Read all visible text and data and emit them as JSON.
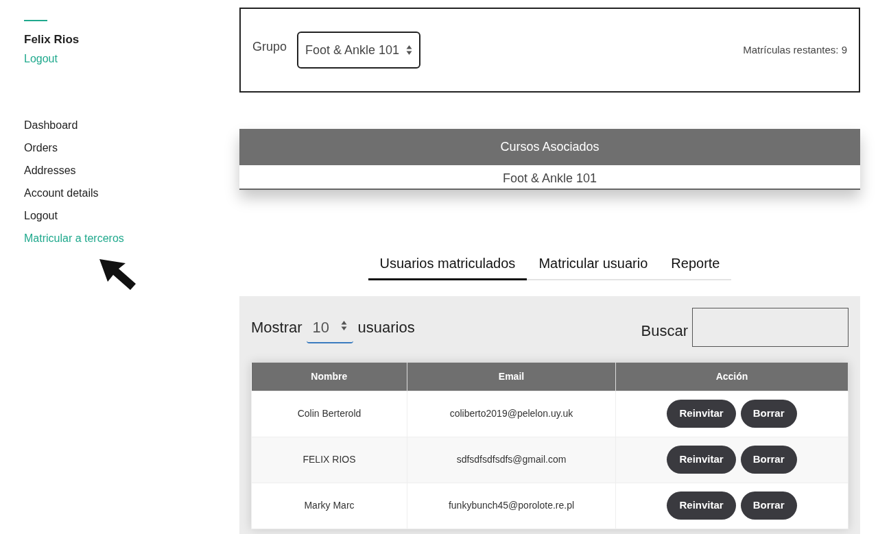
{
  "user": {
    "name": "Felix Rios",
    "logout": "Logout"
  },
  "sidebar": {
    "items": [
      {
        "label": "Dashboard",
        "selected": false
      },
      {
        "label": "Orders",
        "selected": false
      },
      {
        "label": "Addresses",
        "selected": false
      },
      {
        "label": "Account details",
        "selected": false
      },
      {
        "label": "Logout",
        "selected": false
      },
      {
        "label": "Matricular a terceros",
        "selected": true
      }
    ]
  },
  "group": {
    "label": "Grupo",
    "value": "Foot & Ankle 101",
    "remaining": "Matrículas restantes: 9"
  },
  "courses": {
    "title": "Cursos Asociados",
    "items": [
      "Foot & Ankle 101"
    ]
  },
  "tabs": [
    {
      "label": "Usuarios matriculados",
      "selected": true
    },
    {
      "label": "Matricular usuario",
      "selected": false
    },
    {
      "label": "Reporte",
      "selected": false
    }
  ],
  "controls": {
    "show_label": "Mostrar",
    "show_value": "10",
    "show_suffix": "usuarios",
    "search_label": "Buscar"
  },
  "table": {
    "columns": [
      "Nombre",
      "Email",
      "Acción"
    ],
    "rows": [
      {
        "name": "Colin Berterold",
        "email": "coliberto2019@pelelon.uy.uk",
        "actions": [
          "Reinvitar",
          "Borrar"
        ]
      },
      {
        "name": "FELIX RIOS",
        "email": "sdfsdfsdfsdfs@gmail.com",
        "actions": [
          "Reinvitar",
          "Borrar"
        ]
      },
      {
        "name": "Marky Marc",
        "email": "funkybunch45@porolote.re.pl",
        "actions": [
          "Reinvitar",
          "Borrar"
        ]
      }
    ]
  }
}
